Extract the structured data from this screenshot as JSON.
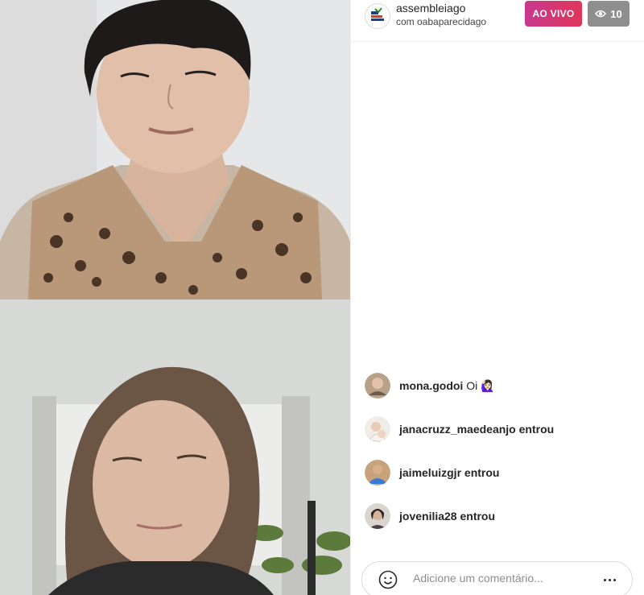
{
  "header": {
    "host_username": "assembleiago",
    "host_subtitle": "com oabaparecidago",
    "live_label": "AO VIVO",
    "viewer_count": "10"
  },
  "comments": [
    {
      "username": "mona.godoi",
      "message": "Oi 🙋🏻‍♀️",
      "action": ""
    },
    {
      "username": "janacruzz_maedeanjo",
      "message": "",
      "action": "entrou"
    },
    {
      "username": "jaimeluizgjr",
      "message": "",
      "action": "entrou"
    },
    {
      "username": "jovenilia28",
      "message": "",
      "action": "entrou"
    }
  ],
  "composer": {
    "placeholder": "Adicione um comentário..."
  },
  "colors": {
    "live_gradient_start": "#c8388f",
    "live_gradient_end": "#e0355a",
    "viewer_badge": "#8e8e8e",
    "text": "#262626"
  },
  "icons": {
    "viewers": "eye-icon",
    "emoji": "smiley-icon",
    "more": "ellipsis-icon"
  }
}
